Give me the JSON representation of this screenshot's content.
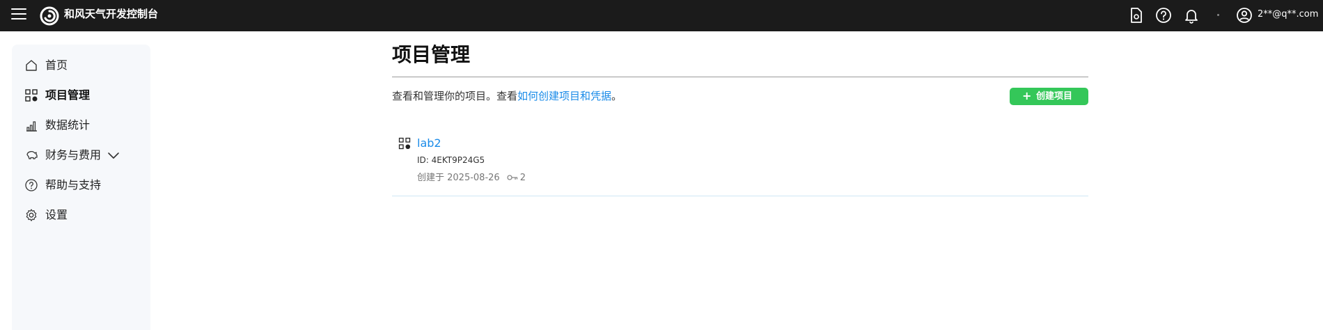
{
  "topbar": {
    "brand": "和风天气开发控制台",
    "user_email": "2**@q**.com",
    "icons": [
      "menu-icon",
      "logo-icon",
      "document-icon",
      "help-icon",
      "bell-icon",
      "user-icon"
    ]
  },
  "sidebar": {
    "items": [
      {
        "label": "首页",
        "icon": "home-icon"
      },
      {
        "label": "项目管理",
        "icon": "grid-icon",
        "active": true
      },
      {
        "label": "数据统计",
        "icon": "bar-chart-icon"
      },
      {
        "label": "财务与费用",
        "icon": "piggy-bank-icon",
        "expandable": true
      },
      {
        "label": "帮助与支持",
        "icon": "help-icon"
      },
      {
        "label": "设置",
        "icon": "gear-icon"
      }
    ]
  },
  "main": {
    "title": "项目管理",
    "description_prefix": "查看和管理你的项目。查看",
    "description_link": "如何创建项目和凭据",
    "description_suffix": "。",
    "create_button": "创建项目",
    "projects": [
      {
        "name": "lab2",
        "id_text": "ID: 4EKT9P24G5",
        "created_text": "创建于 2025-08-26",
        "key_count": "2"
      }
    ]
  },
  "colors": {
    "topbar": "#1b1b1b",
    "link": "#1a8be8",
    "create_button": "#34c759",
    "sidebar_bg": "#f6f8fb"
  }
}
